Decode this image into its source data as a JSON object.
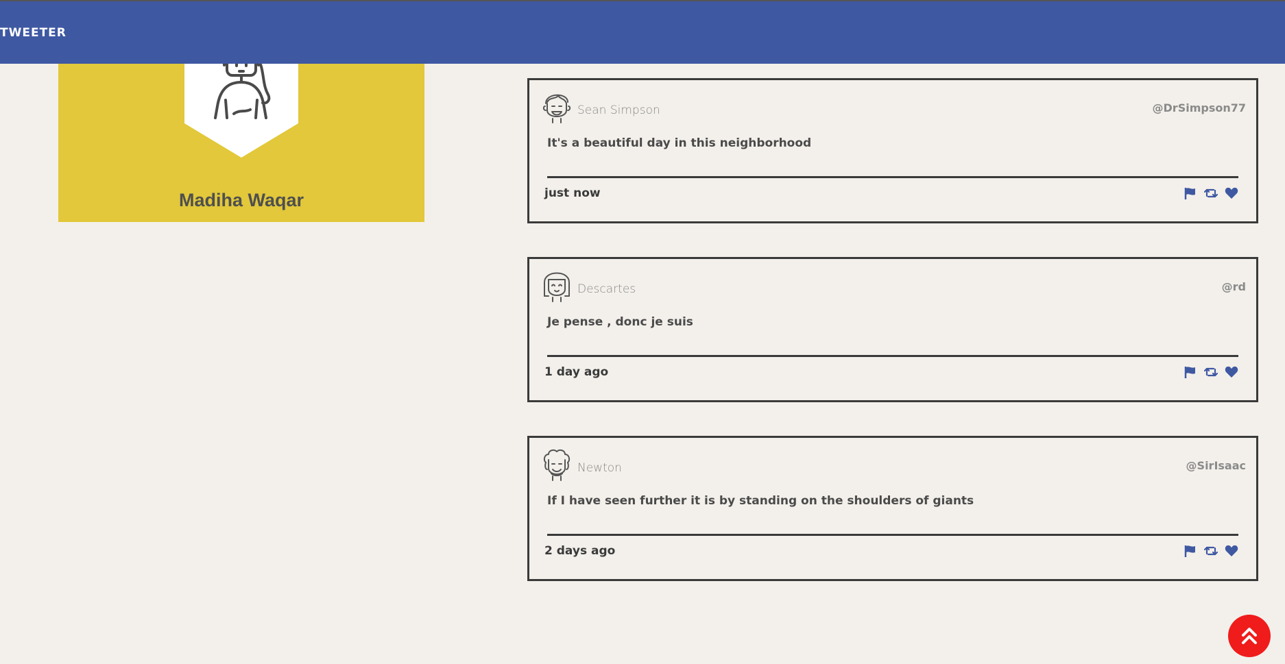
{
  "app": {
    "brand": "TWEETER"
  },
  "profile": {
    "name": "Madiha Waqar",
    "avatar_icon": "profile-avatar-icon"
  },
  "tweets": [
    {
      "author": "Sean Simpson",
      "handle": "@DrSimpson77",
      "content": "It's a beautiful day in this neighborhood",
      "time": "just now",
      "avatar_icon": "man-avatar-icon"
    },
    {
      "author": "Descartes",
      "handle": "@rd",
      "content": "Je pense , donc je suis",
      "time": "1 day ago",
      "avatar_icon": "woman-avatar-icon"
    },
    {
      "author": "Newton",
      "handle": "@SirIsaac",
      "content": "If I have seen further it is by standing on the shoulders of giants",
      "time": "2 days ago",
      "avatar_icon": "curly-hair-avatar-icon"
    }
  ],
  "actions": [
    "flag-icon",
    "retweet-icon",
    "heart-icon"
  ],
  "colors": {
    "navbar": "#3f58a2",
    "profile_card": "#e2c83a",
    "background": "#f3f0eb",
    "action_icon": "#3f58a2",
    "scroll_button": "#f01b1b"
  }
}
